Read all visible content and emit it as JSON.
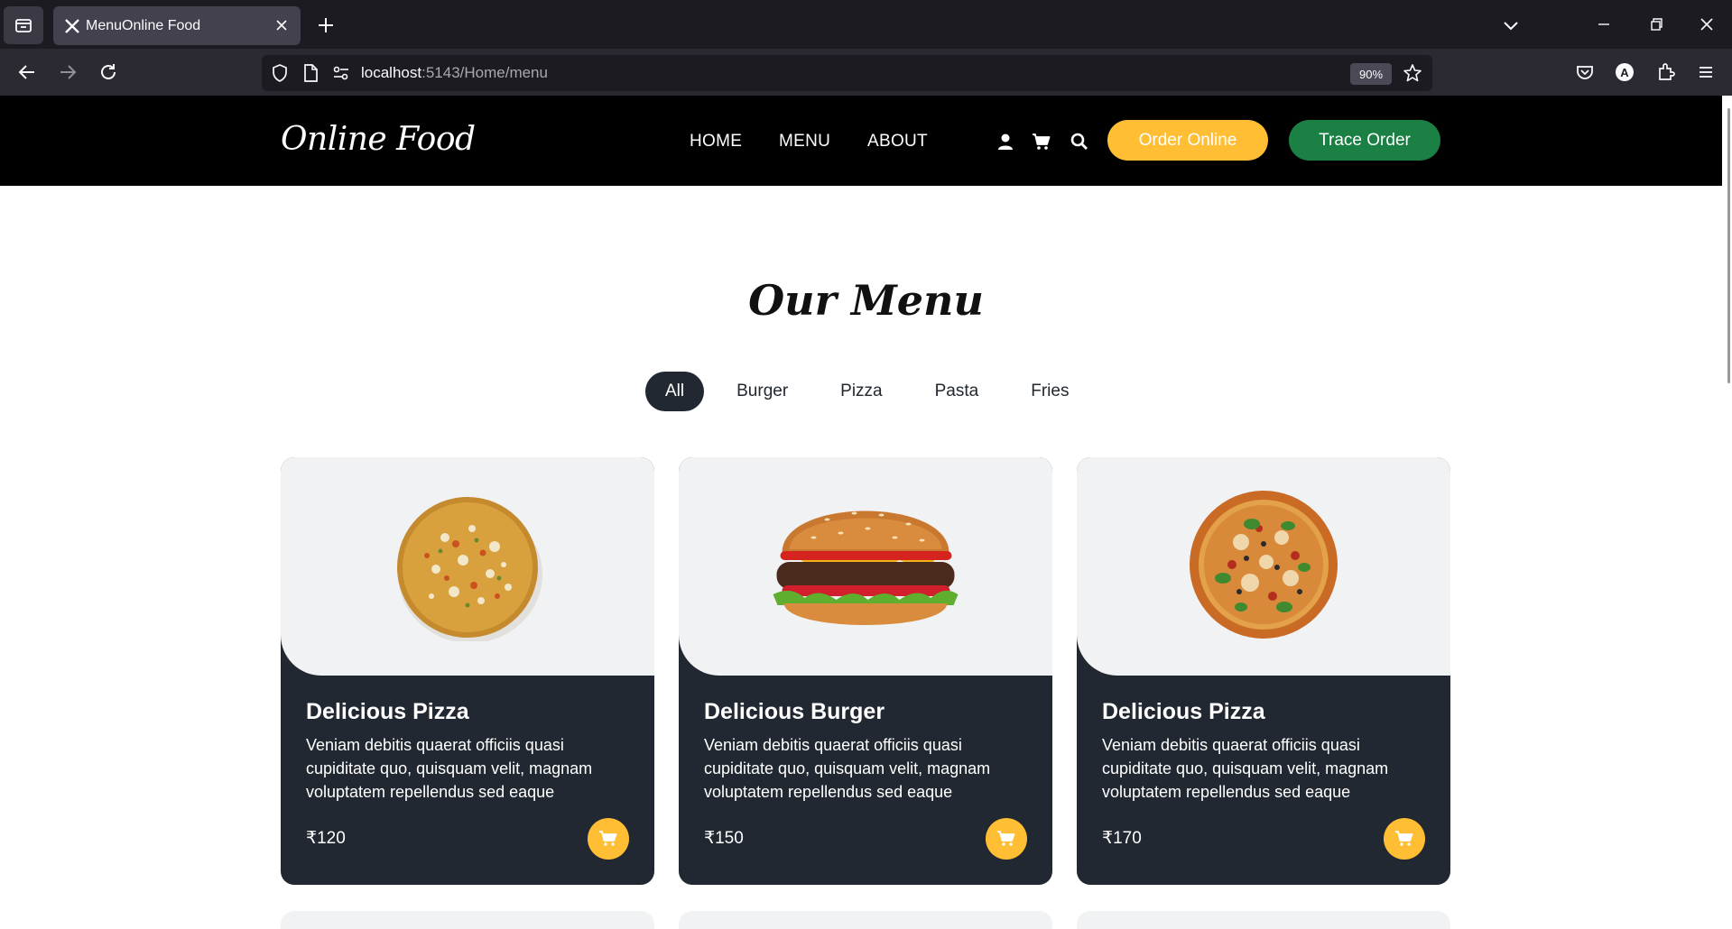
{
  "browser": {
    "tab_title": "MenuOnline Food",
    "url_host": "localhost",
    "url_rest": ":5143/Home/menu",
    "zoom": "90%"
  },
  "site": {
    "logo": "Online Food",
    "nav": [
      "HOME",
      "MENU",
      "ABOUT"
    ],
    "order_button": "Order Online",
    "trace_button": "Trace Order",
    "colors": {
      "accent": "#ffbe33",
      "trace": "#1a8043",
      "dark": "#222831"
    }
  },
  "menu": {
    "title": "Our Menu",
    "filters": [
      "All",
      "Burger",
      "Pizza",
      "Pasta",
      "Fries"
    ],
    "active_filter": "All",
    "items": [
      {
        "name": "Delicious Pizza",
        "description": "Veniam debitis quaerat officiis quasi cupiditate quo, quisquam velit, magnam voluptatem repellendus sed eaque",
        "price": "₹120",
        "image": "pizza-1"
      },
      {
        "name": "Delicious Burger",
        "description": "Veniam debitis quaerat officiis quasi cupiditate quo, quisquam velit, magnam voluptatem repellendus sed eaque",
        "price": "₹150",
        "image": "burger"
      },
      {
        "name": "Delicious Pizza",
        "description": "Veniam debitis quaerat officiis quasi cupiditate quo, quisquam velit, magnam voluptatem repellendus sed eaque",
        "price": "₹170",
        "image": "pizza-2"
      }
    ]
  }
}
